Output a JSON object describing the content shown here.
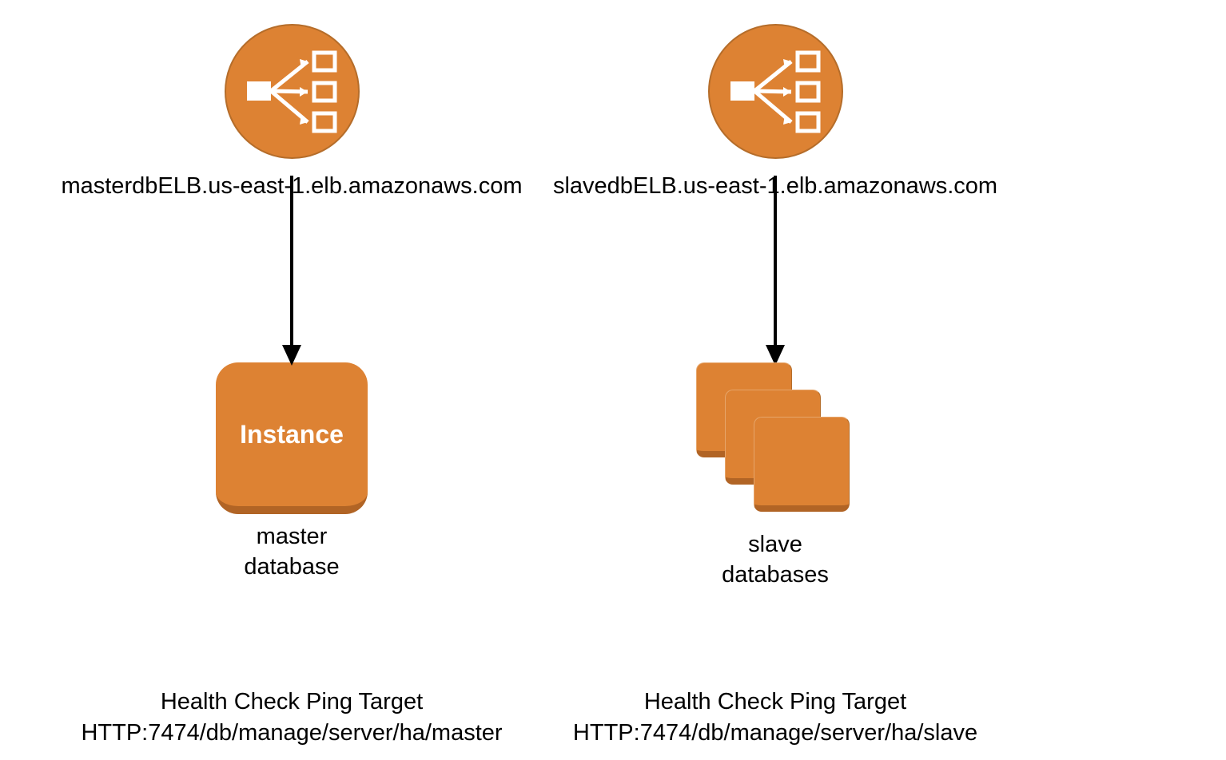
{
  "left": {
    "icon": "load-balancer-icon",
    "hostname": "masterdbELB.us-east-1.elb.amazonaws.com",
    "instanceLabel": "Instance",
    "targetLine1": "master",
    "targetLine2": "database",
    "hcLine1": "Health Check Ping Target",
    "hcLine2": "HTTP:7474/db/manage/server/ha/master"
  },
  "right": {
    "icon": "load-balancer-icon",
    "hostname": "slavedbELB.us-east-1.elb.amazonaws.com",
    "targetLine1": "slave",
    "targetLine2": "databases",
    "hcLine1": "Health Check Ping Target",
    "hcLine2": "HTTP:7474/db/manage/server/ha/slave"
  },
  "colors": {
    "awsOrange": "#dd8233",
    "awsOrangeDark": "#b16425"
  }
}
